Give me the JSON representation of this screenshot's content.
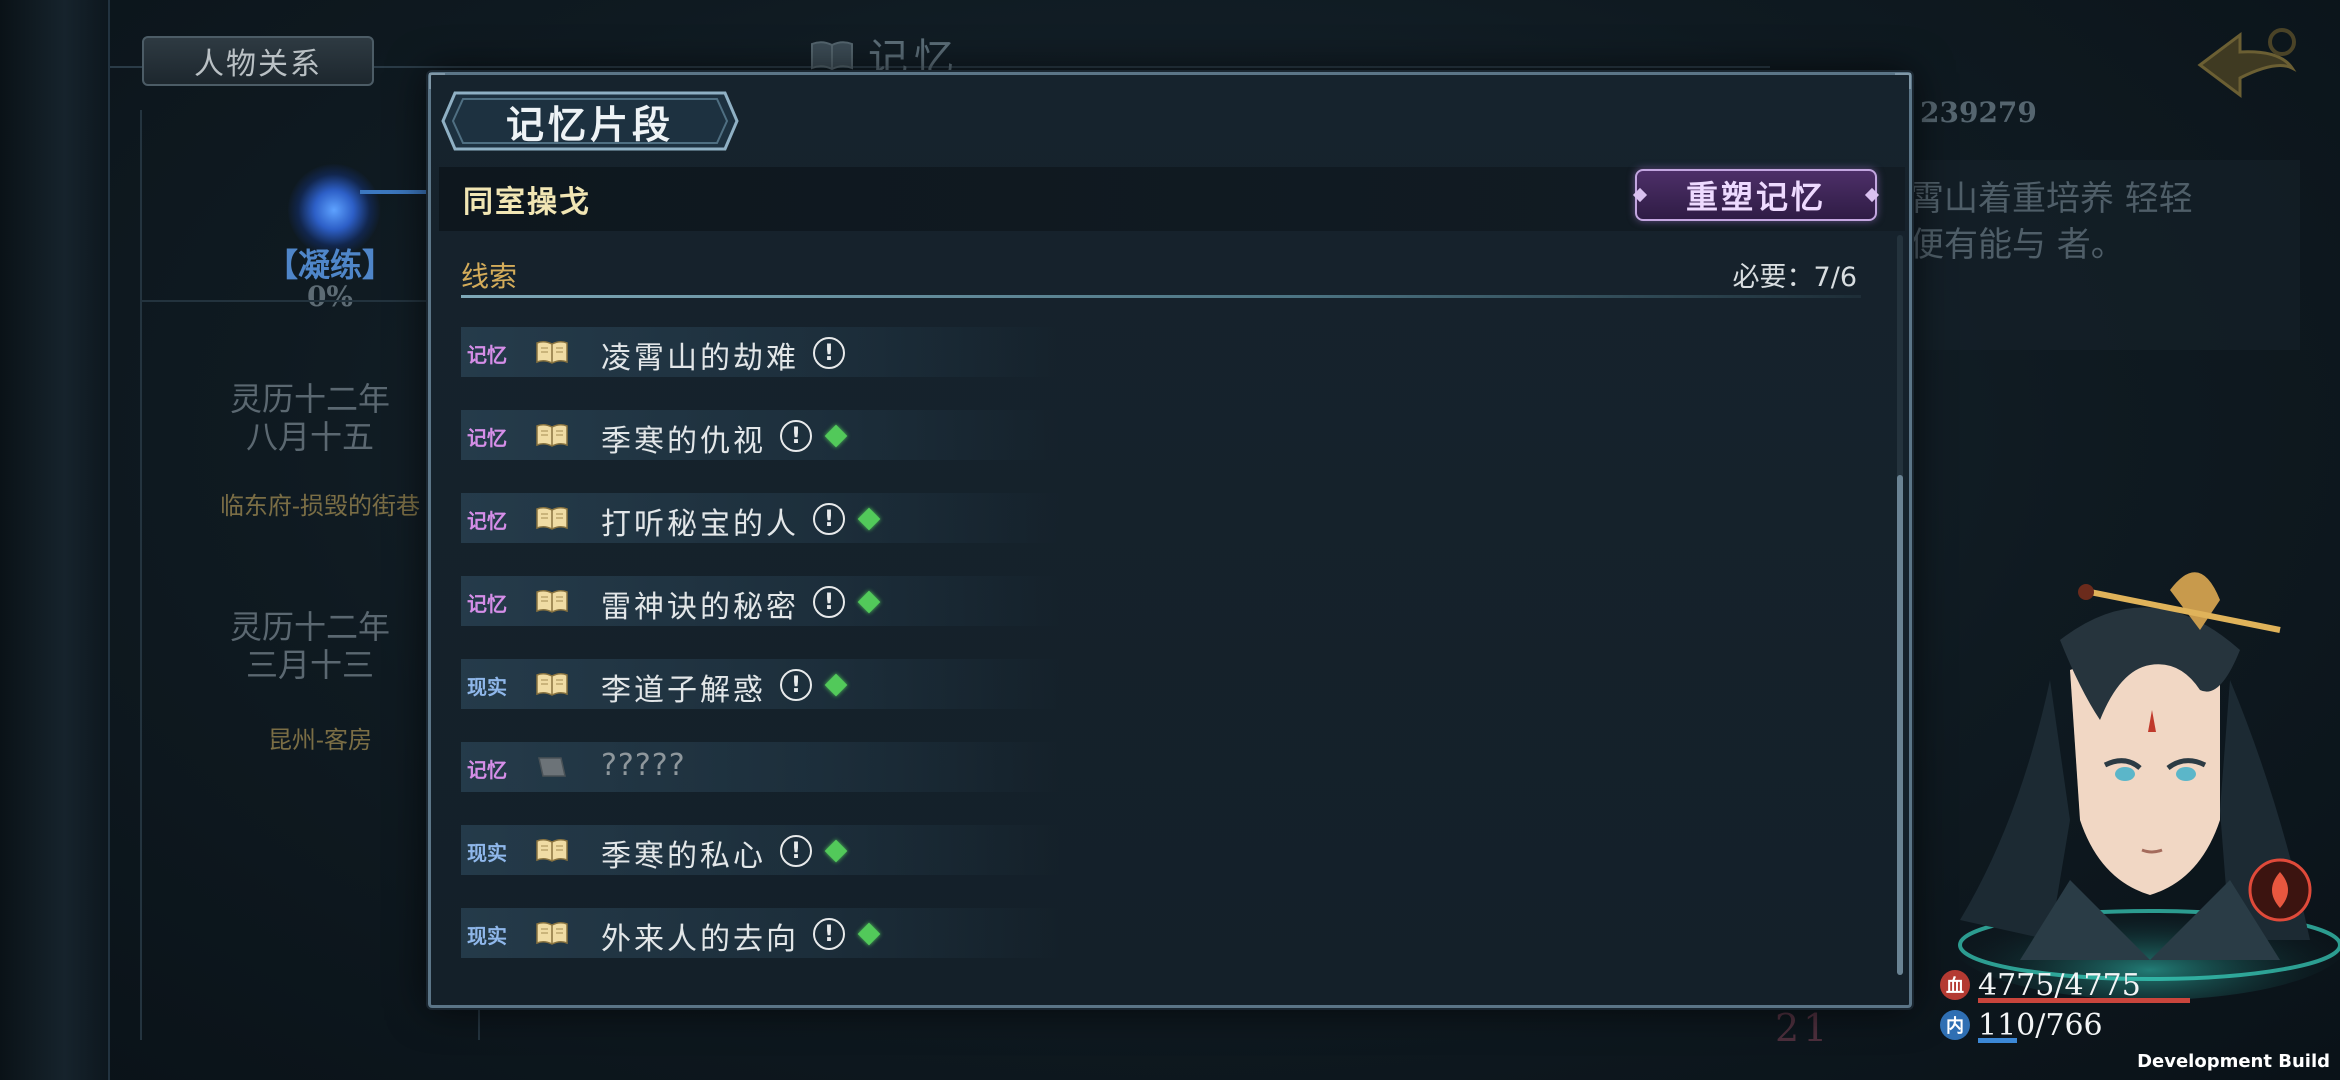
{
  "background": {
    "relation_tab": "人物关系",
    "section_title": "记忆",
    "refine_label": "【凝练】",
    "refine_percent": "0%",
    "entries": [
      {
        "date_line1": "灵历十二年",
        "date_line2": "八月十五",
        "place": "临东府-损毁的街巷"
      },
      {
        "date_line1": "灵历十二年",
        "date_line2": "三月十三",
        "place": "昆州-客房"
      }
    ],
    "right_id": "239279",
    "right_text": "霄山着重培养 轻轻便有能与 者。",
    "stage_number": "21"
  },
  "modal": {
    "title": "记忆片段",
    "fragment_name": "同室操戈",
    "reshape_button": "重塑记忆",
    "clues_heading": "线索",
    "required_label": "必要：7/6",
    "clues": [
      {
        "tag": "记忆",
        "tag_type": "memory",
        "text": "凌霄山的劫难",
        "unlocked": true,
        "alert": true,
        "gem": false
      },
      {
        "tag": "记忆",
        "tag_type": "memory",
        "text": "季寒的仇视",
        "unlocked": true,
        "alert": true,
        "gem": true
      },
      {
        "tag": "记忆",
        "tag_type": "memory",
        "text": "打听秘宝的人",
        "unlocked": true,
        "alert": true,
        "gem": true
      },
      {
        "tag": "记忆",
        "tag_type": "memory",
        "text": "雷神诀的秘密",
        "unlocked": true,
        "alert": true,
        "gem": true
      },
      {
        "tag": "现实",
        "tag_type": "reality",
        "text": "李道子解惑",
        "unlocked": true,
        "alert": true,
        "gem": true
      },
      {
        "tag": "记忆",
        "tag_type": "memory",
        "text": "?????",
        "unlocked": false,
        "alert": false,
        "gem": false
      },
      {
        "tag": "现实",
        "tag_type": "reality",
        "text": "季寒的私心",
        "unlocked": true,
        "alert": true,
        "gem": true
      },
      {
        "tag": "现实",
        "tag_type": "reality",
        "text": "外来人的去向",
        "unlocked": true,
        "alert": true,
        "gem": true
      }
    ]
  },
  "character": {
    "hp_icon": "血",
    "hp": "4775/4775",
    "mp_icon": "内",
    "mp": "110/766",
    "mp_fraction": 0.14
  },
  "footer": {
    "dev_build": "Development Build"
  },
  "colors": {
    "memory_tag": "#d58ee8",
    "reality_tag": "#8fb7ea",
    "gem": "#52c95a",
    "reshape_accent": "#c3a6e0",
    "fragment_name": "#f1e6b4",
    "clue_heading": "#d4ac5a"
  }
}
